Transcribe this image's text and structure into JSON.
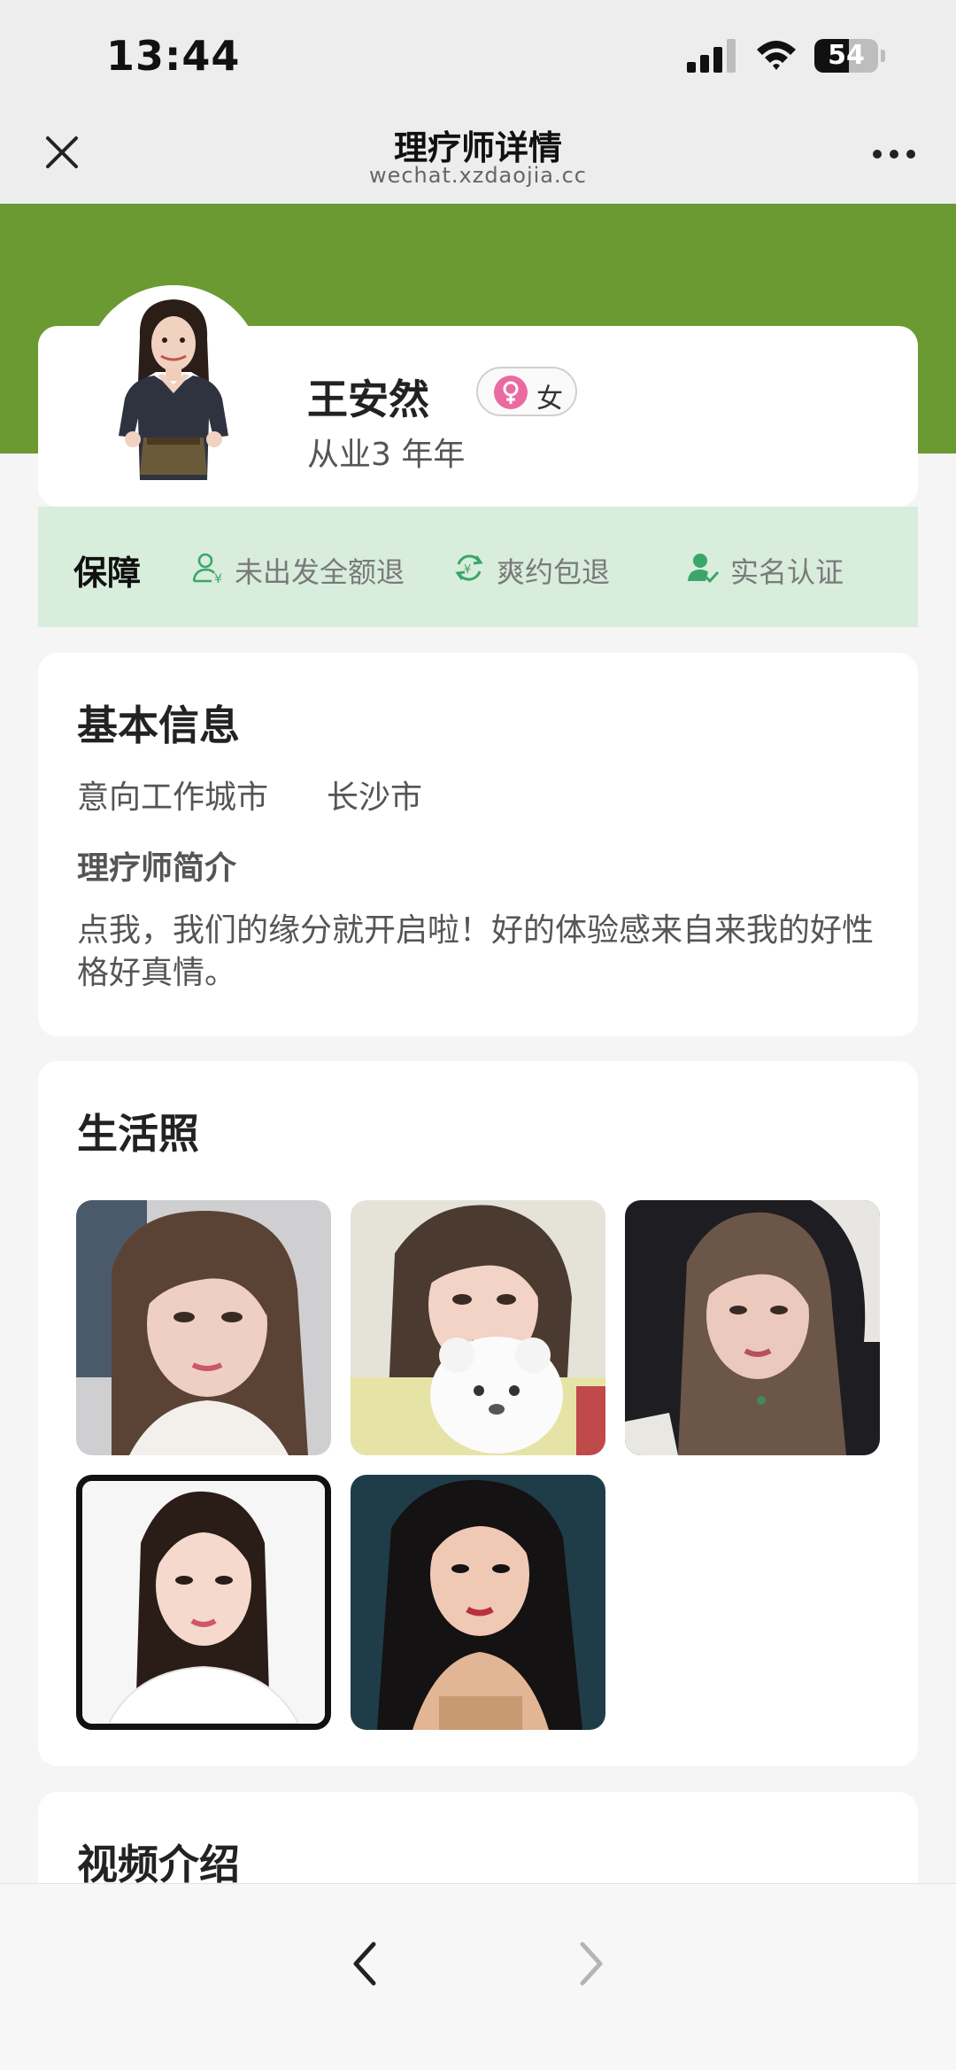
{
  "status_bar": {
    "time": "13:44",
    "battery_percent": 54,
    "battery_label": "54",
    "signal_icon": "cellular-signal-icon",
    "wifi_icon": "wifi-icon"
  },
  "nav": {
    "title": "理疗师详情",
    "url": "wechat.xzdaojia.cc",
    "close_icon": "close-icon",
    "more_icon": "more-icon"
  },
  "theme": {
    "header_green": "#6a9a31",
    "guarantee_bg": "#d8eddc",
    "icon_green": "#3aa66a",
    "female_pink": "#ea6aa2"
  },
  "profile": {
    "name": "王安然",
    "gender": "女",
    "experience": "从业3 年年"
  },
  "guarantee": {
    "title": "保障",
    "items": [
      {
        "icon": "refund-icon",
        "label": "未出发全额退"
      },
      {
        "icon": "refresh-icon",
        "label": "爽约包退"
      },
      {
        "icon": "verified-user-icon",
        "label": "实名认证"
      }
    ]
  },
  "basic_info": {
    "title": "基本信息",
    "city_label": "意向工作城市",
    "city_value": "长沙市",
    "intro_title": "理疗师简介",
    "intro_text": "点我，我们的缘分就开启啦！好的体验感来自来我的好性格好真情。"
  },
  "life_photos": {
    "title": "生活照",
    "count": 5
  },
  "video_intro": {
    "title": "视频介绍"
  },
  "toolbar": {
    "back_icon": "chevron-left-icon",
    "forward_icon": "chevron-right-icon"
  }
}
